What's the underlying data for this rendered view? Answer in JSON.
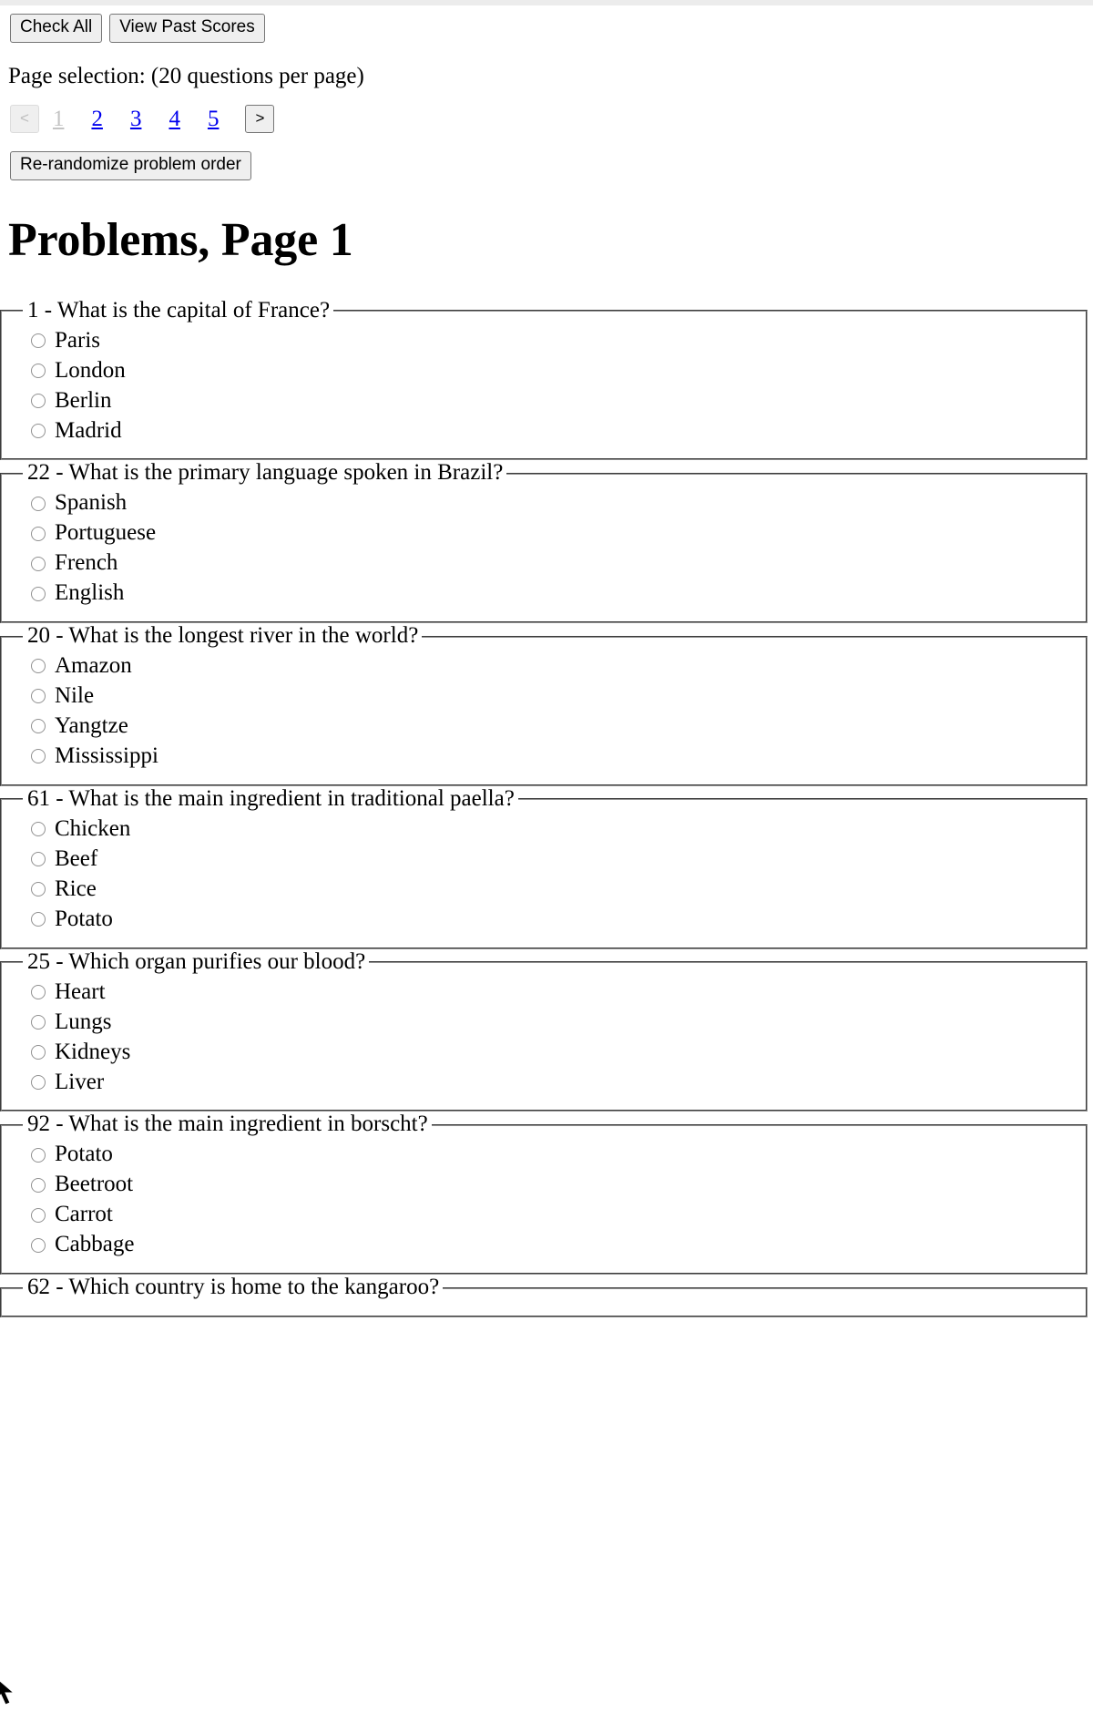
{
  "toolbar": {
    "check_all_label": "Check All",
    "view_past_scores_label": "View Past Scores"
  },
  "page_selection": {
    "label": "Page selection: (20 questions per page)",
    "prev_label": "<",
    "next_label": ">",
    "current_page": "1",
    "pages": [
      "1",
      "2",
      "3",
      "4",
      "5"
    ]
  },
  "rerandomize": {
    "label": "Re-randomize problem order"
  },
  "heading": {
    "title": "Problems, Page 1"
  },
  "problems": [
    {
      "legend": "1 - What is the capital of France?",
      "options": [
        "Paris",
        "London",
        "Berlin",
        "Madrid"
      ]
    },
    {
      "legend": "22 - What is the primary language spoken in Brazil?",
      "options": [
        "Spanish",
        "Portuguese",
        "French",
        "English"
      ]
    },
    {
      "legend": "20 - What is the longest river in the world?",
      "options": [
        "Amazon",
        "Nile",
        "Yangtze",
        "Mississippi"
      ]
    },
    {
      "legend": "61 - What is the main ingredient in traditional paella?",
      "options": [
        "Chicken",
        "Beef",
        "Rice",
        "Potato"
      ]
    },
    {
      "legend": "25 - Which organ purifies our blood?",
      "options": [
        "Heart",
        "Lungs",
        "Kidneys",
        "Liver"
      ]
    },
    {
      "legend": "92 - What is the main ingredient in borscht?",
      "options": [
        "Potato",
        "Beetroot",
        "Carrot",
        "Cabbage"
      ]
    },
    {
      "legend": "62 - Which country is home to the kangaroo?",
      "options": []
    }
  ],
  "colors": {
    "link": "#0000ee",
    "button_bg": "#efefef",
    "button_border": "#767676",
    "fieldset_border": "#8f8f8f",
    "disabled_text": "#c4c4c4"
  }
}
